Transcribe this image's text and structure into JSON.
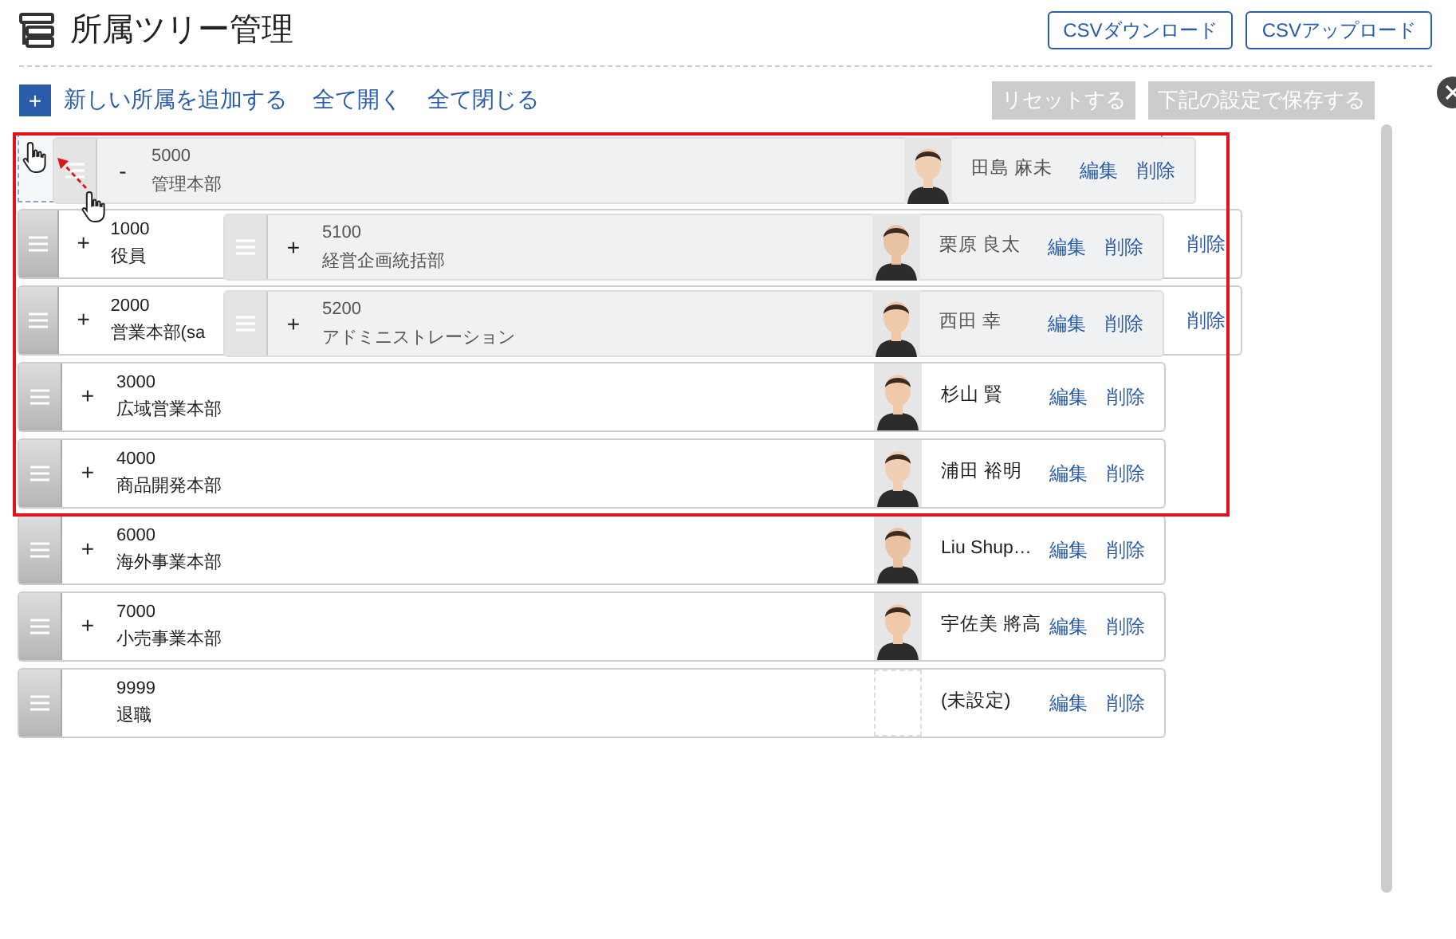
{
  "title": "所属ツリー管理",
  "header_buttons": [
    "CSVダウンロード",
    "CSVアップロード"
  ],
  "toolbar": {
    "add_icon": "+",
    "add": "新しい所属を追加する",
    "expand_all": "全て開く",
    "collapse_all": "全て閉じる",
    "reset": {
      "label": "リセットする",
      "disabled": true
    },
    "save": {
      "label": "下記の設定で保存する",
      "disabled": true
    }
  },
  "dragging": {
    "code": "5000",
    "name": "管理本部",
    "toggle": "-",
    "photo": true,
    "person": "田島 麻未",
    "edit": "編集",
    "delete": "削除",
    "children": [
      {
        "code": "5100",
        "name": "経営企画統括部",
        "toggle": "+",
        "photo": true,
        "person": "栗原 良太",
        "edit": "編集",
        "delete": "削除"
      },
      {
        "code": "5200",
        "name": "アドミニストレーション",
        "toggle": "+",
        "photo": true,
        "person": "西田 幸",
        "edit": "編集",
        "delete": "削除"
      }
    ]
  },
  "rows": [
    {
      "code": "1000",
      "name": "役員",
      "toggle": "+",
      "delete": "削除"
    },
    {
      "code": "2000",
      "name": "営業本部(sa",
      "toggle": "+",
      "delete": "削除"
    },
    {
      "code": "3000",
      "name": "広域営業本部",
      "toggle": "+",
      "photo": true,
      "person": "杉山 賢",
      "edit": "編集",
      "delete": "削除"
    },
    {
      "code": "4000",
      "name": "商品開発本部",
      "toggle": "+",
      "photo": true,
      "person": "浦田 裕明",
      "edit": "編集",
      "delete": "削除"
    },
    {
      "code": "6000",
      "name": "海外事業本部",
      "toggle": "+",
      "photo": true,
      "person": "Liu Shup…",
      "edit": "編集",
      "delete": "削除"
    },
    {
      "code": "7000",
      "name": "小売事業本部",
      "toggle": "+",
      "photo": true,
      "person": "宇佐美 將高",
      "edit": "編集",
      "delete": "削除"
    },
    {
      "code": "9999",
      "name": "退職",
      "photo": false,
      "person": "(未設定)",
      "edit": "編集",
      "delete": "削除"
    }
  ]
}
